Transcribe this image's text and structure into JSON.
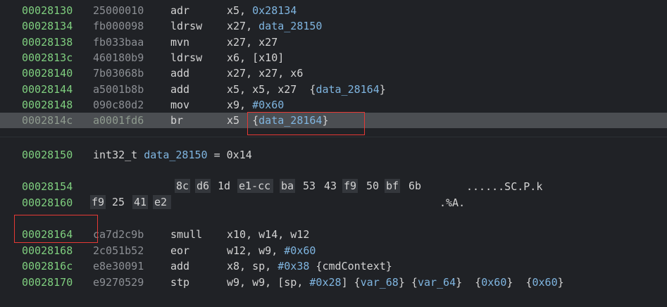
{
  "rows": [
    {
      "addr": "00028130",
      "bytes": "25000010",
      "mn": "adr",
      "ops": [
        {
          "t": "x5, ",
          "c": ""
        },
        {
          "t": "0x28134",
          "c": "num"
        }
      ]
    },
    {
      "addr": "00028134",
      "bytes": "fb000098",
      "mn": "ldrsw",
      "ops": [
        {
          "t": "x27, ",
          "c": ""
        },
        {
          "t": "data_28150",
          "c": "sym"
        }
      ]
    },
    {
      "addr": "00028138",
      "bytes": "fb033baa",
      "mn": "mvn",
      "ops": [
        {
          "t": "x27, x27",
          "c": ""
        }
      ]
    },
    {
      "addr": "0002813c",
      "bytes": "460180b9",
      "mn": "ldrsw",
      "ops": [
        {
          "t": "x6, [x10]",
          "c": ""
        }
      ]
    },
    {
      "addr": "00028140",
      "bytes": "7b03068b",
      "mn": "add",
      "ops": [
        {
          "t": "x27, x27, x6",
          "c": ""
        }
      ]
    },
    {
      "addr": "00028144",
      "bytes": "a5001b8b",
      "mn": "add",
      "ops": [
        {
          "t": "x5, x5, x27  {",
          "c": ""
        },
        {
          "t": "data_28164",
          "c": "sym"
        },
        {
          "t": "}",
          "c": ""
        }
      ]
    },
    {
      "addr": "00028148",
      "bytes": "090c80d2",
      "mn": "mov",
      "ops": [
        {
          "t": "x9, ",
          "c": ""
        },
        {
          "t": "#0x60",
          "c": "num"
        }
      ]
    },
    {
      "addr": "0002814c",
      "bytes": "a0001fd6",
      "mn": "br",
      "ops": [
        {
          "t": "x5  {",
          "c": ""
        },
        {
          "t": "data_28164",
          "c": "sym"
        },
        {
          "t": "}",
          "c": ""
        }
      ],
      "highlight": true
    }
  ],
  "data_decl": {
    "addr": "00028150",
    "type": "int32_t ",
    "name": "data_28150",
    "rest": " = 0x14"
  },
  "hex_rows": [
    {
      "addr": "00028154",
      "cells": [
        "8c",
        "d6",
        "1d",
        "e1-cc",
        "ba",
        "53",
        "43",
        "f9",
        "50",
        "bf",
        "6b"
      ],
      "ascii": "......SC.P.k"
    },
    {
      "addr": "00028160",
      "cells": [
        "f9",
        "25",
        "41",
        "e2"
      ],
      "ascii": ".%A."
    }
  ],
  "rows2": [
    {
      "addr": "00028164",
      "bytes": "ca7d2c9b",
      "mn": "smull",
      "ops": [
        {
          "t": "x10, w14, w12",
          "c": ""
        }
      ]
    },
    {
      "addr": "00028168",
      "bytes": "2c051b52",
      "mn": "eor",
      "ops": [
        {
          "t": "w12, w9, ",
          "c": ""
        },
        {
          "t": "#0x60",
          "c": "num"
        }
      ]
    },
    {
      "addr": "0002816c",
      "bytes": "e8e30091",
      "mn": "add",
      "ops": [
        {
          "t": "x8, sp, ",
          "c": ""
        },
        {
          "t": "#0x38",
          "c": "num"
        },
        {
          "t": " {cmdContext}",
          "c": ""
        }
      ]
    },
    {
      "addr": "00028170",
      "bytes": "e9270529",
      "mn": "stp",
      "ops": [
        {
          "t": "w9, w9, [sp, ",
          "c": ""
        },
        {
          "t": "#0x28",
          "c": "num"
        },
        {
          "t": "] {",
          "c": ""
        },
        {
          "t": "var_68",
          "c": "sym"
        },
        {
          "t": "} {",
          "c": ""
        },
        {
          "t": "var_64",
          "c": "sym"
        },
        {
          "t": "}  {",
          "c": ""
        },
        {
          "t": "0x60",
          "c": "sym"
        },
        {
          "t": "}  {",
          "c": ""
        },
        {
          "t": "0x60",
          "c": "sym"
        },
        {
          "t": "}",
          "c": ""
        }
      ]
    }
  ],
  "colors": {
    "background": "#202226",
    "address": "#7fcf7f",
    "symbol": "#7fb5e0",
    "highlight_row": "#4b4e52",
    "annotation_box": "#e53935"
  }
}
